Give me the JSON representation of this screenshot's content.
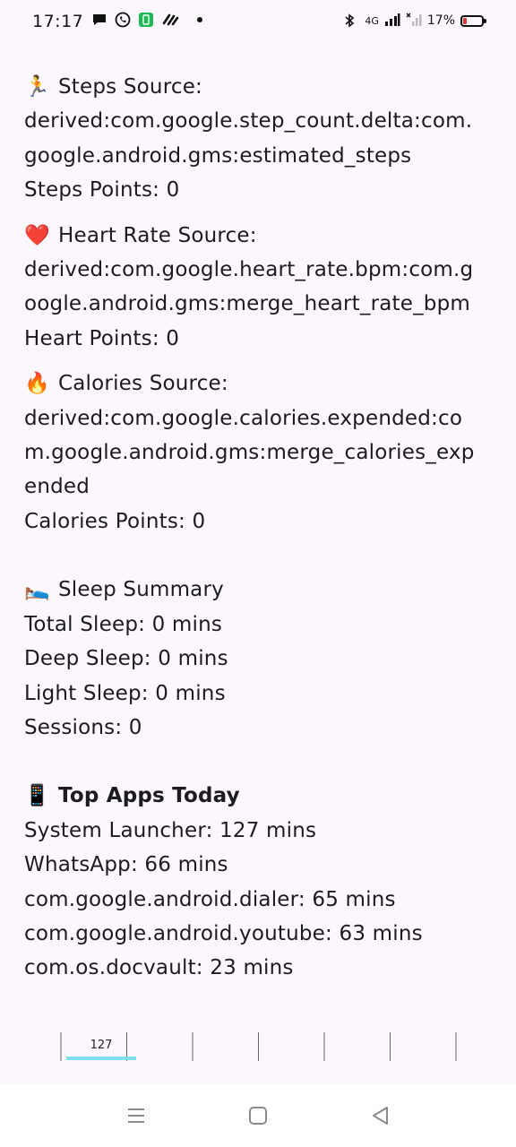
{
  "status_bar": {
    "time": "17:17",
    "network": "4G",
    "battery": "17%",
    "icons": [
      "chat-icon",
      "whatsapp-icon",
      "app-icon",
      "link-icon",
      "notification-dot",
      "bluetooth-icon",
      "signal-icon",
      "signal-2-icon",
      "battery-icon"
    ]
  },
  "sections": {
    "steps": {
      "emoji": "🏃",
      "title": "Steps Source:",
      "source_1": "derived:com.google.step_count.delta:com.",
      "source_2": "google.android.gms:estimated_steps",
      "points": "Steps Points: 0"
    },
    "heart": {
      "emoji": "❤️",
      "title": "Heart Rate Source:",
      "source_1": "derived:com.google.heart_rate.bpm:com.g",
      "source_2": "oogle.android.gms:merge_heart_rate_bpm",
      "points": "Heart Points: 0"
    },
    "calories": {
      "emoji": "🔥",
      "title": "Calories Source:",
      "source_1": "derived:com.google.calories.expended:co",
      "source_2": "m.google.android.gms:merge_calories_exp",
      "source_3": "ended",
      "points": "Calories Points: 0"
    },
    "sleep": {
      "emoji": "🛌",
      "title": "Sleep Summary",
      "total": "Total Sleep: 0 mins",
      "deep": "Deep Sleep: 0 mins",
      "light": "Light Sleep: 0 mins",
      "sessions": "Sessions: 0"
    },
    "apps": {
      "emoji": "📱",
      "title": "Top Apps Today",
      "items": [
        "System Launcher: 127 mins",
        "WhatsApp: 66 mins",
        "com.google.android.dialer: 65 mins",
        "com.google.android.youtube: 63 mins",
        "com.os.docvault: 23 mins"
      ]
    }
  },
  "chart_data": {
    "type": "bar",
    "categories": [
      "",
      "",
      "",
      "",
      "",
      ""
    ],
    "values": [
      127,
      0,
      0,
      0,
      0,
      0
    ],
    "data_labels": [
      "127"
    ],
    "bar_color": "#80deea",
    "ylim": [
      0,
      127
    ]
  },
  "nav_bar": {
    "icons": [
      "menu-icon",
      "home-icon",
      "back-icon"
    ]
  },
  "colors": {
    "background": "#fcf7fc",
    "text": "#1c1b1f",
    "battery_low": "#e53935",
    "bar": "#80deea"
  }
}
